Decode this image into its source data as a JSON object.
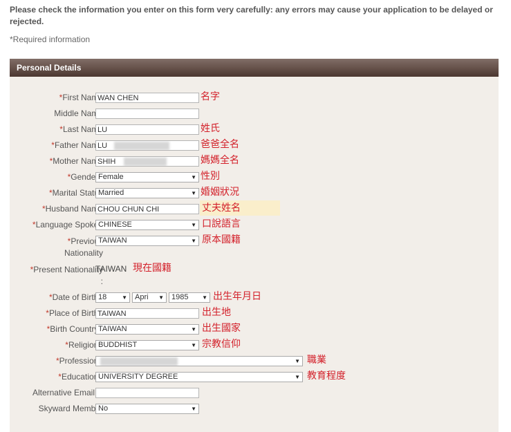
{
  "notice": {
    "warning": "Please check the information you enter on this form very carefully: any errors may cause your application to be delayed or rejected.",
    "required": "*Required information"
  },
  "panel": {
    "title": "Personal Details"
  },
  "fields": {
    "first_name": {
      "label": "First Name",
      "value": "WAN CHEN",
      "annotation": "名字"
    },
    "middle_name": {
      "label": "Middle Name",
      "value": ""
    },
    "last_name": {
      "label": "Last Name",
      "value": "LU",
      "annotation": "姓氏"
    },
    "father_name": {
      "label": "Father Name",
      "value": "LU",
      "annotation": "爸爸全名"
    },
    "mother_name": {
      "label": "Mother Name",
      "value": "SHIH",
      "annotation": "媽媽全名"
    },
    "gender": {
      "label": "Gender :",
      "value": "Female",
      "annotation": "性別"
    },
    "marital_status": {
      "label": "Marital Status",
      "value": "Married",
      "annotation": "婚姻狀況"
    },
    "husband_name": {
      "label": "Husband Name",
      "value": "CHOU CHUN CHI",
      "annotation": "丈夫姓名"
    },
    "language": {
      "label": "Language Spoken",
      "value": "CHINESE",
      "annotation": "口說語言"
    },
    "previous_nationality": {
      "label_line1": "Previous",
      "label_line2": "Nationality",
      "value": "TAIWAN",
      "annotation": "原本國籍"
    },
    "present_nationality": {
      "label_line1": "Present Nationality",
      "label_line2": ":",
      "value": "TAIWAN",
      "annotation": "現在國籍"
    },
    "dob": {
      "label": "Date of Birth :",
      "day": "18",
      "month": "Apri",
      "year": "1985",
      "annotation": "出生年月日"
    },
    "place_of_birth": {
      "label": "Place of Birth :",
      "value": "TAIWAN",
      "annotation": "出生地"
    },
    "birth_country": {
      "label": "Birth Country :",
      "value": "TAIWAN",
      "annotation": "出生國家"
    },
    "religion": {
      "label": "Religion :",
      "value": "BUDDHIST",
      "annotation": "宗教信仰"
    },
    "profession": {
      "label": "Profession :",
      "value": "",
      "annotation": "職業"
    },
    "education": {
      "label": "Education :",
      "value": "UNIVERSITY DEGREE",
      "annotation": "教育程度"
    },
    "alt_email": {
      "label": "Alternative EmailID",
      "value": ""
    },
    "skyward": {
      "label": "Skyward Member",
      "value": "No"
    }
  },
  "required_mark": "*",
  "colors": {
    "annotation": "#d3202a",
    "header_top": "#816e67",
    "header_bottom": "#4c3730",
    "panel_bg": "#f2eee9",
    "highlight": "#faeecb"
  }
}
